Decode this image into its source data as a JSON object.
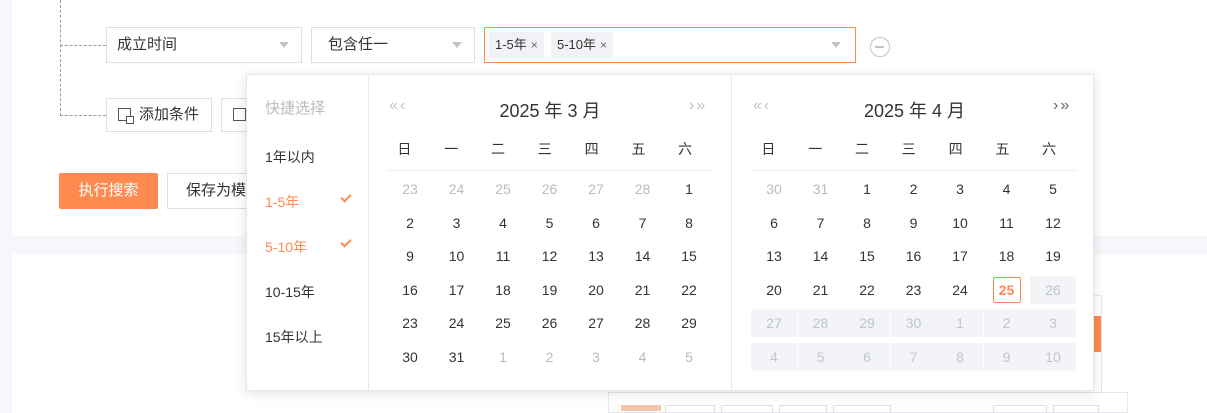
{
  "filter": {
    "field": "成立时间",
    "operator": "包含任一",
    "tags": [
      {
        "label": "1-5年",
        "remove": "×"
      },
      {
        "label": "5-10年",
        "remove": "×"
      }
    ]
  },
  "buttons": {
    "add_condition": "添加条件",
    "search": "执行搜索",
    "save_template": "保存为模板"
  },
  "quick": {
    "title": "快捷选择",
    "items": [
      {
        "label": "1年以内",
        "selected": false
      },
      {
        "label": "1-5年",
        "selected": true
      },
      {
        "label": "5-10年",
        "selected": true
      },
      {
        "label": "10-15年",
        "selected": false
      },
      {
        "label": "15年以上",
        "selected": false
      }
    ]
  },
  "calendars": [
    {
      "title": "2025 年 3 月",
      "prev": "«‹",
      "next": "›»",
      "weekdays": [
        "日",
        "一",
        "二",
        "三",
        "四",
        "五",
        "六"
      ],
      "days": [
        [
          "23",
          "o"
        ],
        [
          "24",
          "o"
        ],
        [
          "25",
          "o"
        ],
        [
          "26",
          "o"
        ],
        [
          "27",
          "o"
        ],
        [
          "28",
          "o"
        ],
        [
          "1",
          "c"
        ],
        [
          "2",
          "c"
        ],
        [
          "3",
          "c"
        ],
        [
          "4",
          "c"
        ],
        [
          "5",
          "c"
        ],
        [
          "6",
          "c"
        ],
        [
          "7",
          "c"
        ],
        [
          "8",
          "c"
        ],
        [
          "9",
          "c"
        ],
        [
          "10",
          "c"
        ],
        [
          "11",
          "c"
        ],
        [
          "12",
          "c"
        ],
        [
          "13",
          "c"
        ],
        [
          "14",
          "c"
        ],
        [
          "15",
          "c"
        ],
        [
          "16",
          "c"
        ],
        [
          "17",
          "c"
        ],
        [
          "18",
          "c"
        ],
        [
          "19",
          "c"
        ],
        [
          "20",
          "c"
        ],
        [
          "21",
          "c"
        ],
        [
          "22",
          "c"
        ],
        [
          "23",
          "c"
        ],
        [
          "24",
          "c"
        ],
        [
          "25",
          "c"
        ],
        [
          "26",
          "c"
        ],
        [
          "27",
          "c"
        ],
        [
          "28",
          "c"
        ],
        [
          "29",
          "c"
        ],
        [
          "30",
          "c"
        ],
        [
          "31",
          "c"
        ],
        [
          "1",
          "o"
        ],
        [
          "2",
          "o"
        ],
        [
          "3",
          "o"
        ],
        [
          "4",
          "o"
        ],
        [
          "5",
          "o"
        ]
      ]
    },
    {
      "title": "2025 年 4 月",
      "prev": "«‹",
      "next": "›»",
      "weekdays": [
        "日",
        "一",
        "二",
        "三",
        "四",
        "五",
        "六"
      ],
      "days": [
        [
          "30",
          "o"
        ],
        [
          "31",
          "o"
        ],
        [
          "1",
          "c"
        ],
        [
          "2",
          "c"
        ],
        [
          "3",
          "c"
        ],
        [
          "4",
          "c"
        ],
        [
          "5",
          "c"
        ],
        [
          "6",
          "c"
        ],
        [
          "7",
          "c"
        ],
        [
          "8",
          "c"
        ],
        [
          "9",
          "c"
        ],
        [
          "10",
          "c"
        ],
        [
          "11",
          "c"
        ],
        [
          "12",
          "c"
        ],
        [
          "13",
          "c"
        ],
        [
          "14",
          "c"
        ],
        [
          "15",
          "c"
        ],
        [
          "16",
          "c"
        ],
        [
          "17",
          "c"
        ],
        [
          "18",
          "c"
        ],
        [
          "19",
          "c"
        ],
        [
          "20",
          "c"
        ],
        [
          "21",
          "c"
        ],
        [
          "22",
          "c"
        ],
        [
          "23",
          "c"
        ],
        [
          "24",
          "c"
        ],
        [
          "25",
          "t"
        ],
        [
          "26",
          "d"
        ],
        [
          "27",
          "d"
        ],
        [
          "28",
          "d"
        ],
        [
          "29",
          "d"
        ],
        [
          "30",
          "d"
        ],
        [
          "1",
          "do"
        ],
        [
          "2",
          "do"
        ],
        [
          "3",
          "do"
        ],
        [
          "4",
          "do"
        ],
        [
          "5",
          "do"
        ],
        [
          "6",
          "do"
        ],
        [
          "7",
          "do"
        ],
        [
          "8",
          "do"
        ],
        [
          "9",
          "do"
        ],
        [
          "10",
          "do"
        ]
      ]
    }
  ],
  "colors": {
    "accent": "#ff8a4f",
    "border": "#dcdfe6"
  }
}
